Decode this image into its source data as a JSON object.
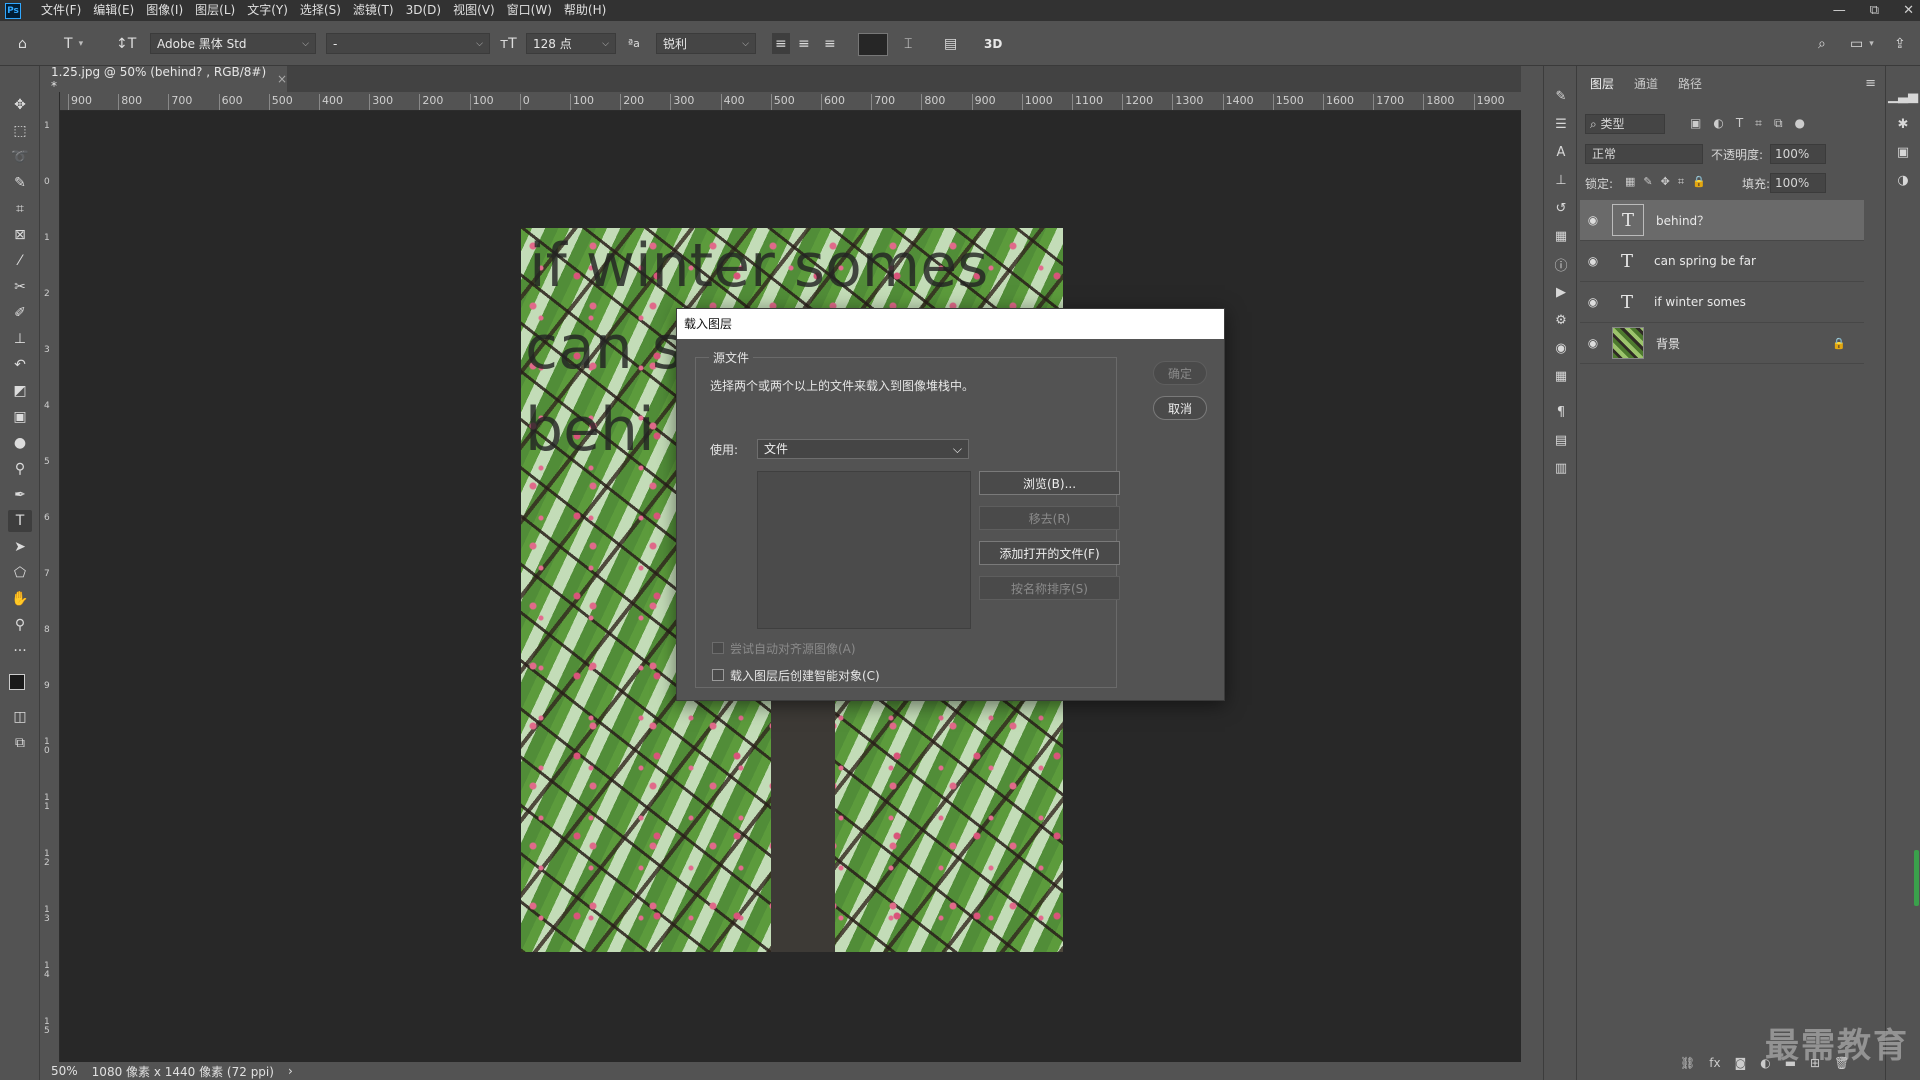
{
  "app": {
    "logo": "Ps"
  },
  "menu": [
    "文件(F)",
    "编辑(E)",
    "图像(I)",
    "图层(L)",
    "文字(Y)",
    "选择(S)",
    "滤镜(T)",
    "3D(D)",
    "视图(V)",
    "窗口(W)",
    "帮助(H)"
  ],
  "window_controls": {
    "minimize": "—",
    "restore": "⧉",
    "close": "✕"
  },
  "options": {
    "font_family": "Adobe 黑体 Std",
    "font_style": "-",
    "font_size": "128 点",
    "aa_icon_text": "ªa",
    "antialias": "锐利",
    "three_d": "3D"
  },
  "document": {
    "tab_title": "1.25.jpg @ 50% (behind? , RGB/8#) *",
    "tab_close": "×",
    "canvas_text": [
      "if winter somes",
      "can s",
      "behi"
    ]
  },
  "ruler": {
    "h_ticks": [
      "900",
      "800",
      "700",
      "600",
      "500",
      "400",
      "300",
      "200",
      "100",
      "0",
      "100",
      "200",
      "300",
      "400",
      "500",
      "600",
      "700",
      "800",
      "900",
      "1000",
      "1100",
      "1200",
      "1300",
      "1400",
      "1500",
      "1600",
      "1700",
      "1800",
      "1900"
    ],
    "v_ticks": [
      "1",
      "0",
      "1",
      "2",
      "3",
      "4",
      "5",
      "6",
      "7",
      "8",
      "9",
      "1 0",
      "1 1",
      "1 2",
      "1 3",
      "1 4",
      "1 5"
    ]
  },
  "status": {
    "zoom": "50%",
    "doc_info": "1080 像素 x 1440 像素 (72 ppi)",
    "arrow": "›"
  },
  "layers_panel": {
    "tabs": [
      "图层",
      "通道",
      "路径"
    ],
    "filter_kind": "类型",
    "blend_mode": "正常",
    "opacity_label": "不透明度:",
    "opacity_value": "100%",
    "lock_label": "锁定:",
    "fill_label": "填充:",
    "fill_value": "100%",
    "layers": [
      {
        "name": "behind？",
        "type": "text",
        "selected": true
      },
      {
        "name": "can spring be far",
        "type": "text",
        "selected": false
      },
      {
        "name": "if winter somes",
        "type": "text",
        "selected": false
      },
      {
        "name": "背景",
        "type": "image",
        "selected": false,
        "locked": true
      }
    ]
  },
  "dialog": {
    "title": "载入图层",
    "group_label": "源文件",
    "description": "选择两个或两个以上的文件来载入到图像堆栈中。",
    "use_label": "使用:",
    "use_value": "文件",
    "ok": "确定",
    "cancel": "取消",
    "browse": "浏览(B)...",
    "remove": "移去(R)",
    "add_open": "添加打开的文件(F)",
    "sort_by_name": "按名称排序(S)",
    "auto_align": "尝试自动对齐源图像(A)",
    "smart_object": "载入图层后创建智能对象(C)"
  },
  "watermark": "最需教育"
}
